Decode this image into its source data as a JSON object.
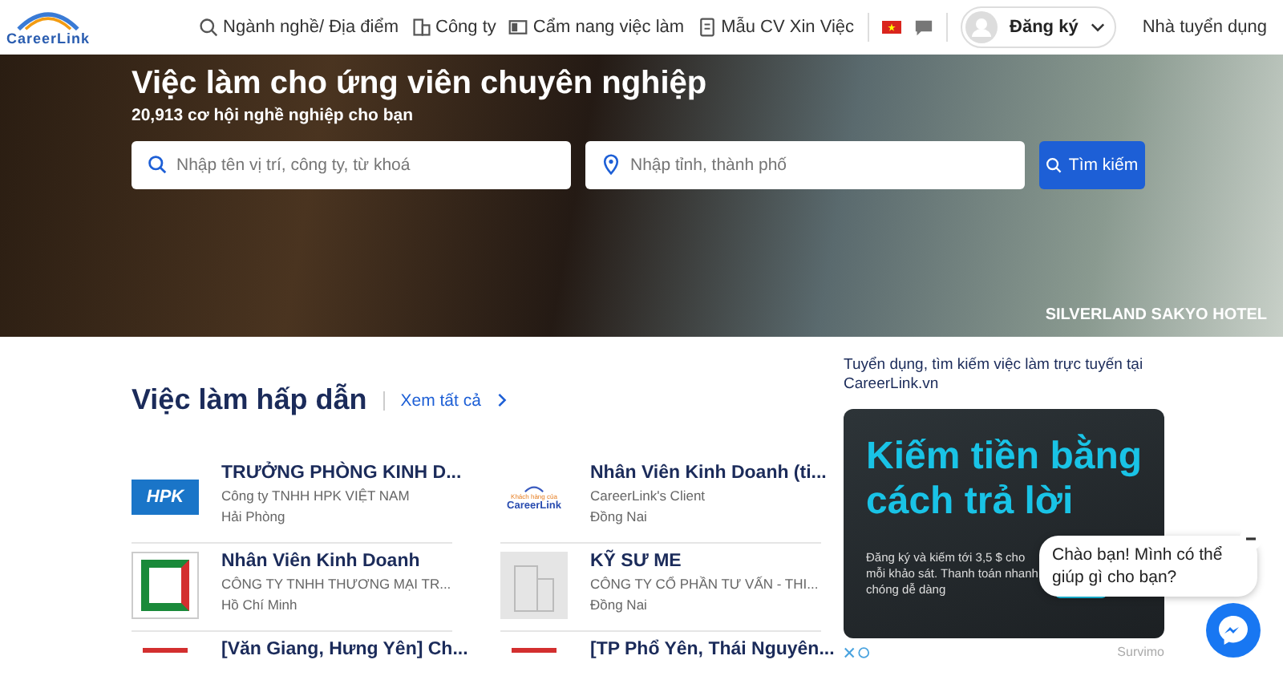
{
  "header": {
    "logo": "CareerLink",
    "nav": [
      {
        "kind": "search",
        "label": "Ngành nghề/ Địa điểm"
      },
      {
        "kind": "building",
        "label": "Công ty"
      },
      {
        "kind": "book",
        "label": "Cẩm nang việc làm"
      },
      {
        "kind": "document",
        "label": "Mẫu CV Xin Việc"
      }
    ],
    "account": "Đăng ký",
    "employer": "Nhà tuyển dụng"
  },
  "hero": {
    "title": "Việc làm cho ứng viên chuyên nghiệp",
    "subtitle": "20,913 cơ hội nghề nghiệp cho bạn",
    "keyword": {
      "placeholder": "Nhập tên vị trí, công ty, từ khoá"
    },
    "location": {
      "placeholder": "Nhập tỉnh, thành phố"
    },
    "search_button": "Tìm kiếm",
    "caption": "SILVERLAND SAKYO HOTEL"
  },
  "jobs": {
    "title": "Việc làm hấp dẫn",
    "see_all": "Xem tất cả",
    "items": [
      {
        "kind": "hpk",
        "logo_text": "HPK",
        "title": "TRƯỞNG PHÒNG KINH D...",
        "company": "Công ty TNHH HPK VIỆT NAM",
        "location": "Hải Phòng"
      },
      {
        "kind": "careerlink",
        "logo_caption": "Khách hàng của",
        "logo_text": "CareerLink",
        "title": "Nhân Viên Kinh Doanh (ti...",
        "company": "CareerLink's Client",
        "location": "Đồng Nai"
      },
      {
        "kind": "square",
        "title": "Nhân Viên Kinh Doanh",
        "company": "CÔNG TY TNHH THƯƠNG MẠI TR...",
        "location": "Hồ Chí Minh"
      },
      {
        "kind": "placeholder",
        "title": "KỸ SƯ ME",
        "company": "CÔNG TY CỔ PHẦN TƯ VẤN - THI...",
        "location": "Đồng Nai"
      },
      {
        "kind": "prudential",
        "title": "[Văn Giang, Hưng Yên] Ch..."
      },
      {
        "kind": "prudential",
        "title": "[TP Phổ Yên, Thái Nguyên..."
      }
    ]
  },
  "sidebar": {
    "intro": "Tuyển dụng, tìm kiếm việc làm trực tuyến tại CareerLink.vn",
    "ad": {
      "headline": "Kiếm tiền bằng cách trả lời",
      "body": "Đăng ký và kiếm tới 3,5 $ cho mỗi khảo sát. Thanh toán nhanh chóng dễ dàng",
      "brand": "Survimo"
    }
  },
  "chat": {
    "message": "Chào bạn! Mình có thể giúp gì cho bạn?"
  }
}
